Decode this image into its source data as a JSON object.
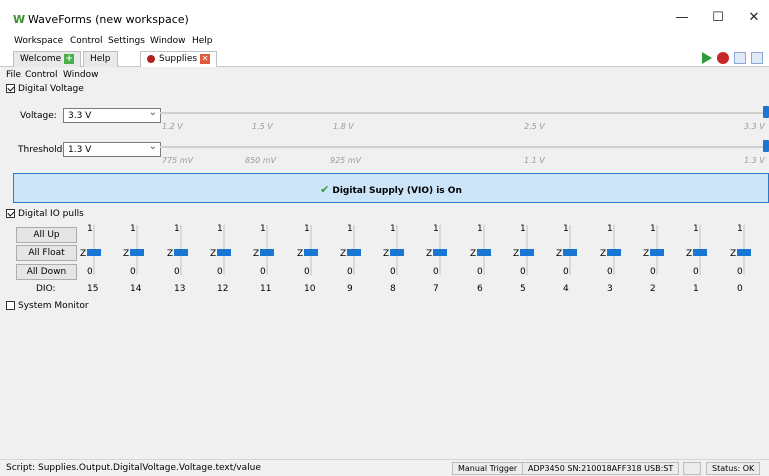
{
  "window": {
    "title": "WaveForms (new workspace)",
    "minimize": "—",
    "maximize": "☐",
    "close": "✕"
  },
  "menu": [
    "Workspace",
    "Control",
    "Settings",
    "Window",
    "Help"
  ],
  "tabs": [
    {
      "label": "Welcome"
    },
    {
      "label": "Help"
    },
    {
      "label": "Supplies"
    }
  ],
  "submenu": [
    "File",
    "Control",
    "Window"
  ],
  "digital_voltage": {
    "title": "Digital Voltage",
    "checked": true,
    "voltage_label": "Voltage:",
    "voltage_value": "3.3 V",
    "voltage_ticks": [
      "1.2 V",
      "1.5 V",
      "1.8 V",
      "2.5 V",
      "3.3 V"
    ],
    "threshold_label": "Threshold:",
    "threshold_value": "1.3 V",
    "threshold_ticks": [
      "775 mV",
      "850 mV",
      "925 mV",
      "1.1 V",
      "1.3 V"
    ]
  },
  "banner": {
    "text": "Digital Supply (VIO) is On"
  },
  "digital_io_pulls": {
    "title": "Digital IO pulls",
    "checked": true,
    "buttons": [
      "All Up",
      "All Float",
      "All Down"
    ],
    "dio_label": "DIO:",
    "pins": [
      "15",
      "14",
      "13",
      "12",
      "11",
      "10",
      "9",
      "8",
      "7",
      "6",
      "5",
      "4",
      "3",
      "2",
      "1",
      "0"
    ],
    "level_up": "1",
    "level_float": "Z",
    "level_down": "0"
  },
  "system_monitor": {
    "title": "System Monitor",
    "checked": false
  },
  "statusbar": {
    "script": "Script: Supplies.Output.DigitalVoltage.Voltage.text/value",
    "trigger": "Manual Trigger",
    "device": "ADP3450 SN:210018AFF318 USB:ST",
    "status": "Status: OK"
  },
  "colors": {
    "accent": "#1976d2",
    "banner_bg": "#cce4f7"
  }
}
